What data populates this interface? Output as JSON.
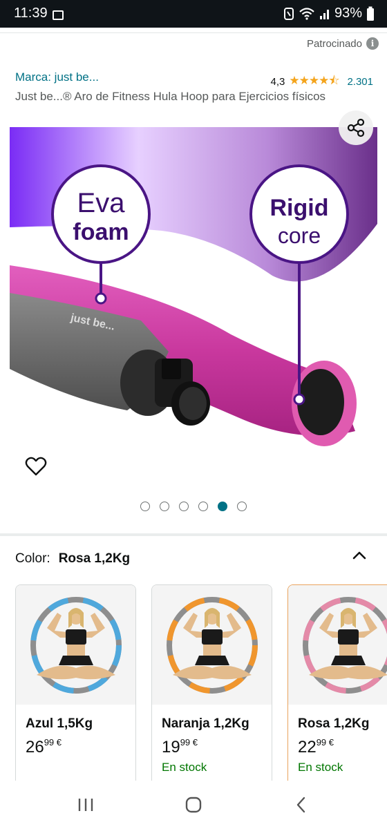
{
  "status_bar": {
    "time": "11:39",
    "battery": "93%",
    "icons": [
      "gallery-icon",
      "nfc-icon",
      "wifi-icon",
      "signal-icon",
      "battery-icon"
    ]
  },
  "sponsored": {
    "label": "Patrocinado",
    "icon": "info-icon"
  },
  "product": {
    "brand": "Marca: just be...",
    "rating_value": "4,3",
    "rating_stars": "★★★★⯪",
    "rating_count": "2.301",
    "title": "Just be...® Aro de Fitness Hula Hoop para Ejercicios físicos"
  },
  "hero_image": {
    "callout_left_line1": "Eva",
    "callout_left_line2": "foam",
    "callout_right_line1": "Rigid",
    "callout_right_line2": "core",
    "tube_print": "just be..."
  },
  "carousel": {
    "total": 6,
    "active_index": 4
  },
  "colors": {
    "accent": "#007185",
    "stock_green": "#007600",
    "star": "#f4a41c",
    "selected_border": "#e9a35d"
  },
  "color_selector": {
    "label": "Color:",
    "value": "Rosa 1,2Kg"
  },
  "variants": [
    {
      "name": "Azul 1,5Kg",
      "price_whole": "26",
      "price_frac": "99",
      "currency": "€",
      "stock": "",
      "hoop_color": "#4fa8dc"
    },
    {
      "name": "Naranja 1,2Kg",
      "price_whole": "19",
      "price_frac": "99",
      "currency": "€",
      "stock": "En stock",
      "hoop_color": "#f0962e"
    },
    {
      "name": "Rosa 1,2Kg",
      "price_whole": "22",
      "price_frac": "99",
      "currency": "€",
      "stock": "En stock",
      "hoop_color": "#e48aa8"
    }
  ]
}
